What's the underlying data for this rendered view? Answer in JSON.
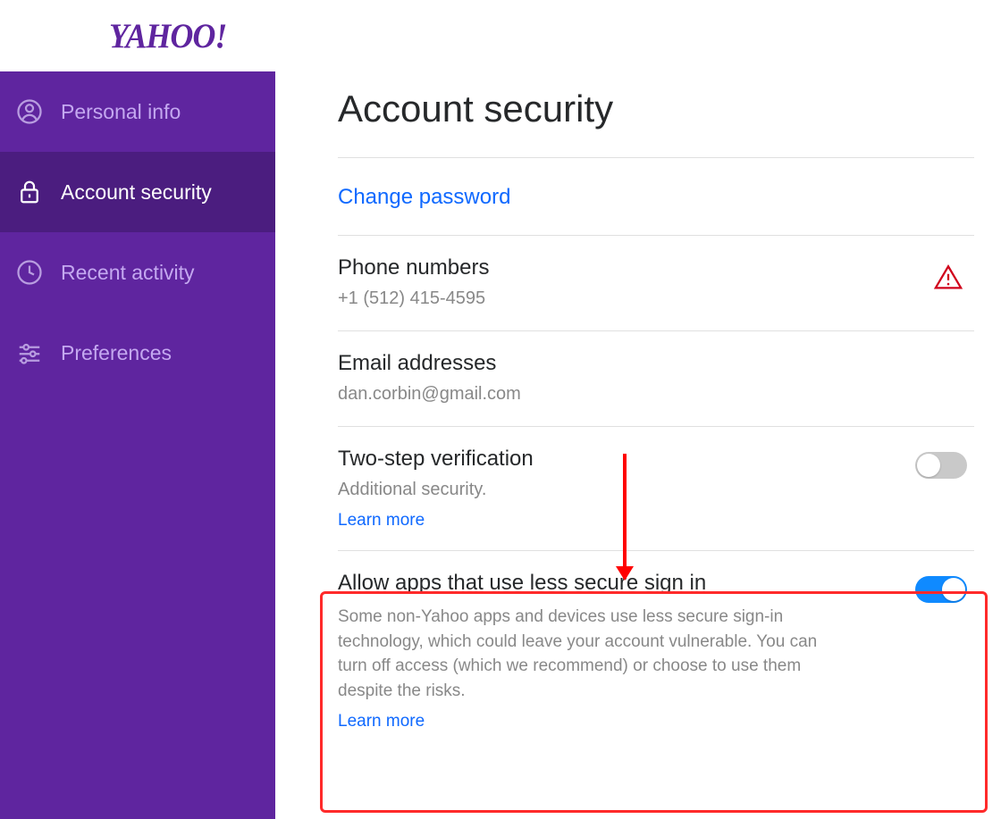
{
  "brand": {
    "name": "YAHOO",
    "punct": "!"
  },
  "sidebar": {
    "items": [
      {
        "label": "Personal info"
      },
      {
        "label": "Account security"
      },
      {
        "label": "Recent activity"
      },
      {
        "label": "Preferences"
      }
    ]
  },
  "page": {
    "title": "Account security"
  },
  "sections": {
    "change_password": {
      "label": "Change password"
    },
    "phone": {
      "title": "Phone numbers",
      "value": "+1 (512) 415-4595"
    },
    "email": {
      "title": "Email addresses",
      "value": "dan.corbin@gmail.com"
    },
    "twostep": {
      "title": "Two-step verification",
      "sub": "Additional security.",
      "learn_more": "Learn more",
      "enabled": false
    },
    "less_secure": {
      "title": "Allow apps that use less secure sign in",
      "desc": "Some non-Yahoo apps and devices use less secure sign-in technology, which could leave your account vulnerable. You can turn off access (which we recommend) or choose to use them despite the risks.",
      "learn_more": "Learn more",
      "enabled": true
    }
  }
}
